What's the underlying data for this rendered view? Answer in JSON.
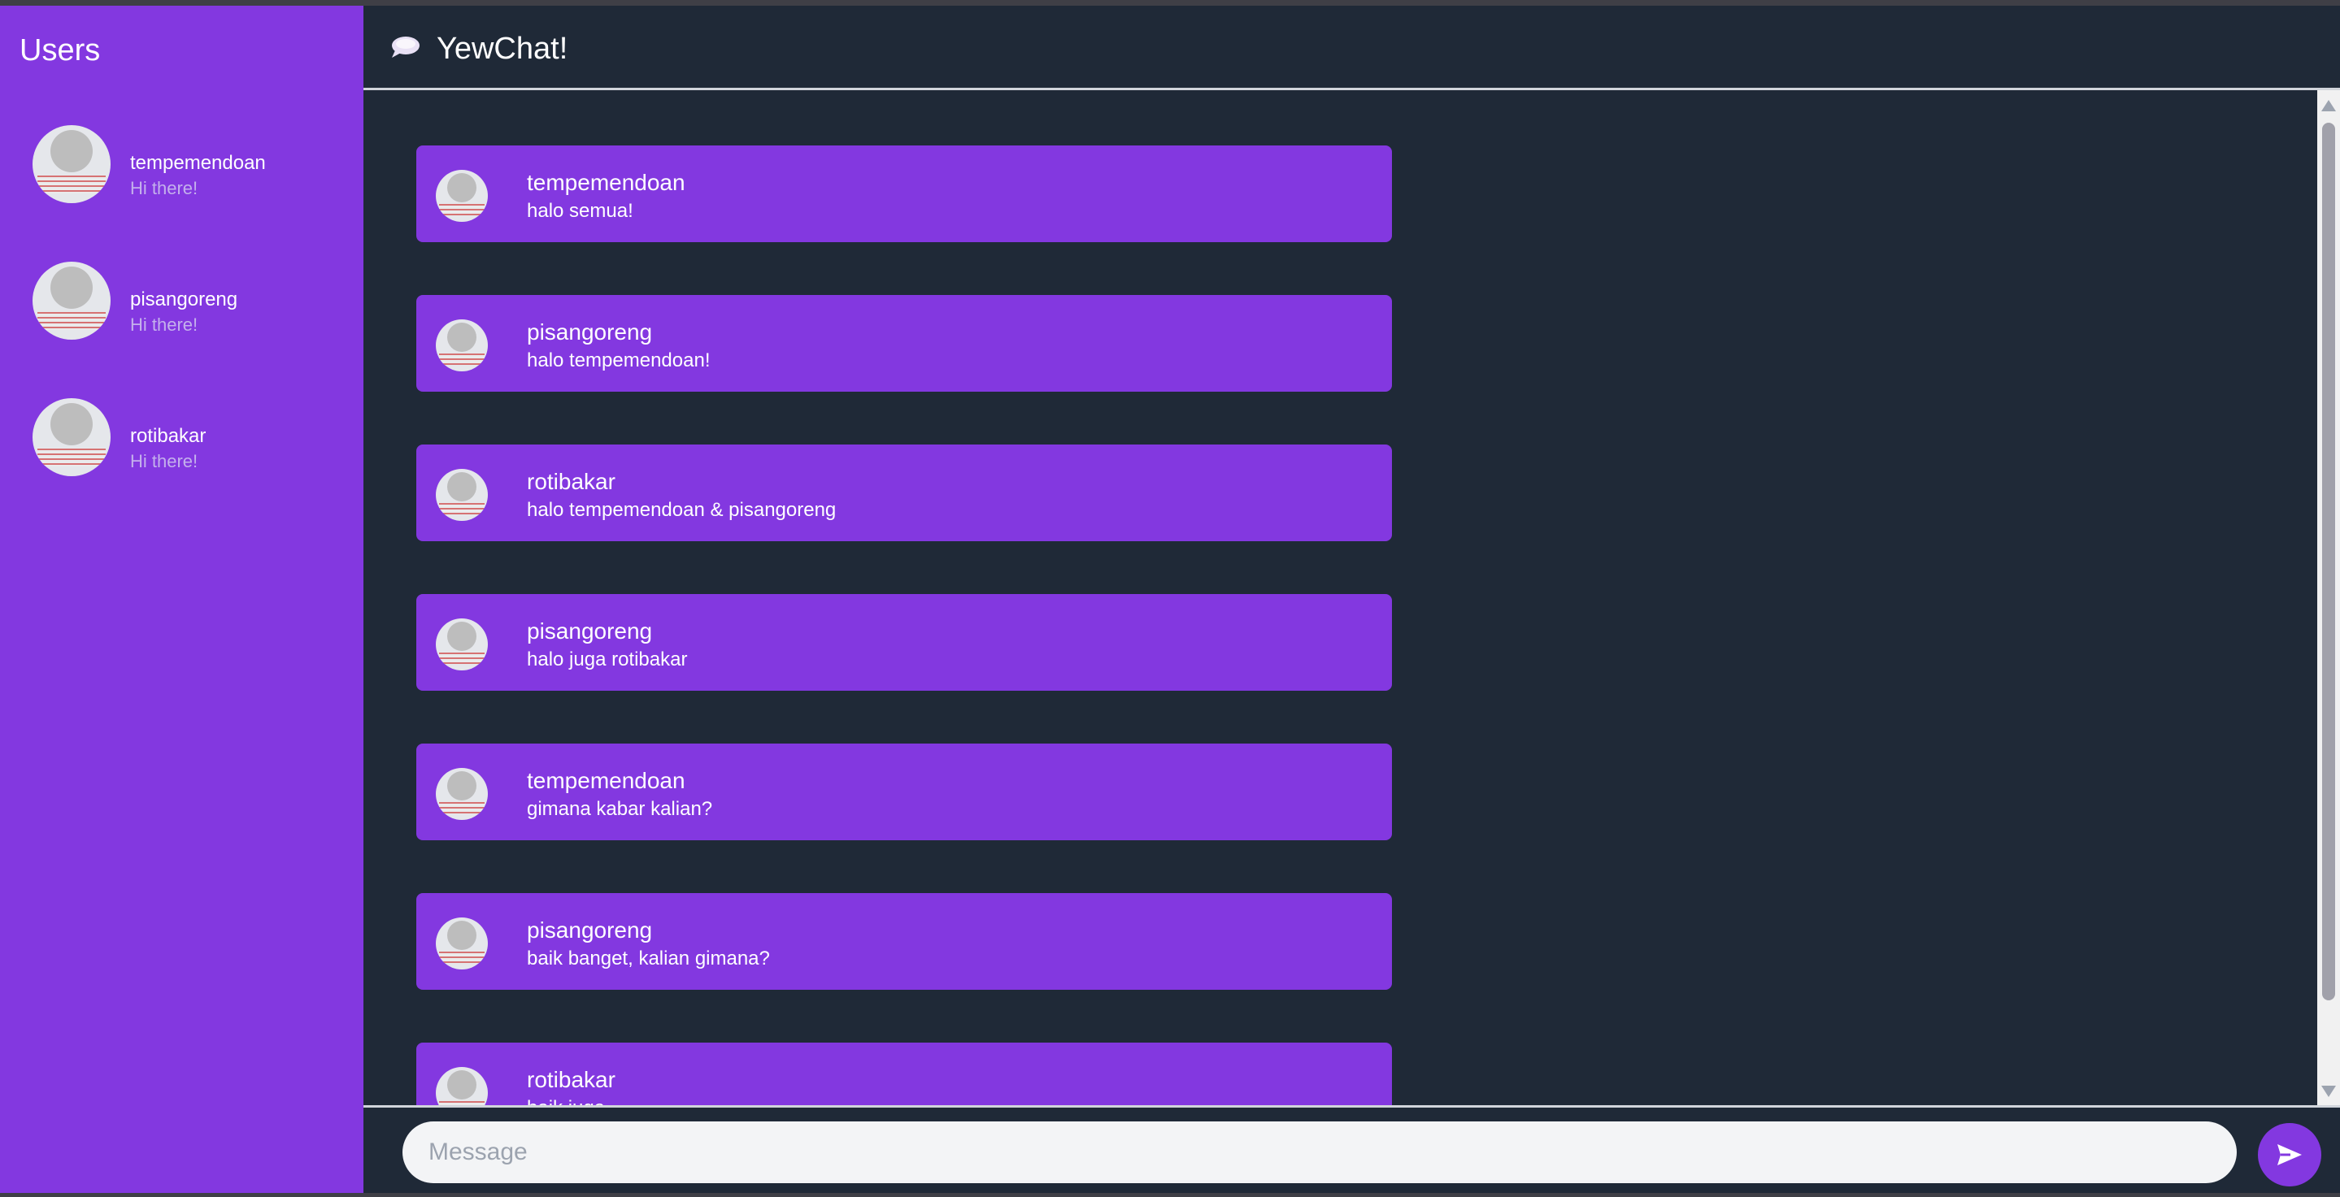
{
  "sidebar": {
    "title": "Users",
    "users": [
      {
        "name": "tempemendoan",
        "status": "Hi there!"
      },
      {
        "name": "pisangoreng",
        "status": "Hi there!"
      },
      {
        "name": "rotibakar",
        "status": "Hi there!"
      }
    ]
  },
  "header": {
    "icon": "chat-bubble-icon",
    "title": "YewChat!"
  },
  "messages": [
    {
      "user": "tempemendoan",
      "text": "halo semua!"
    },
    {
      "user": "pisangoreng",
      "text": "halo tempemendoan!"
    },
    {
      "user": "rotibakar",
      "text": "halo tempemendoan & pisangoreng"
    },
    {
      "user": "pisangoreng",
      "text": "halo juga rotibakar"
    },
    {
      "user": "tempemendoan",
      "text": "gimana kabar kalian?"
    },
    {
      "user": "pisangoreng",
      "text": "baik banget, kalian gimana?"
    },
    {
      "user": "rotibakar",
      "text": "baik juga"
    }
  ],
  "composer": {
    "placeholder": "Message",
    "value": "",
    "send_icon": "send-icon"
  },
  "colors": {
    "accent": "#8338e0",
    "background": "#1f2937"
  }
}
